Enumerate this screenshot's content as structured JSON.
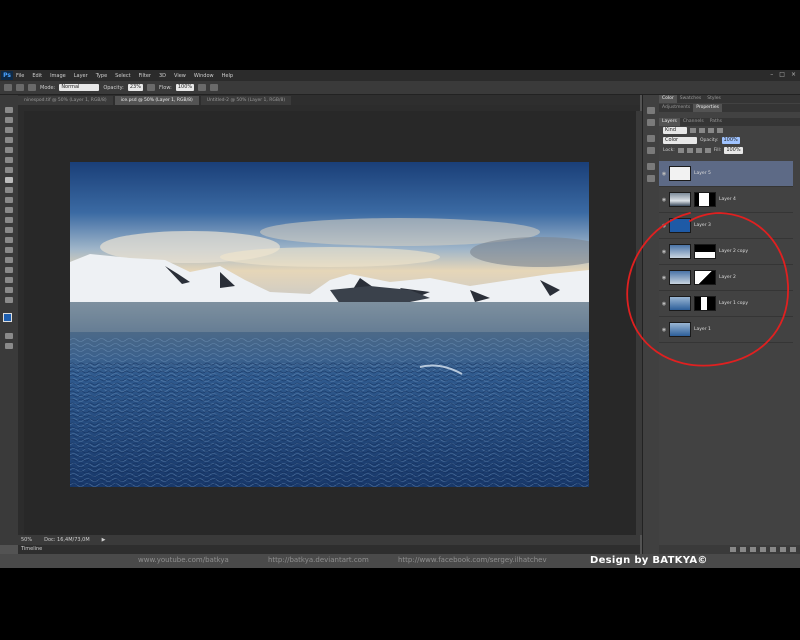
{
  "app": {
    "logo": "Ps",
    "menu": [
      "File",
      "Edit",
      "Image",
      "Layer",
      "Type",
      "Select",
      "Filter",
      "3D",
      "View",
      "Window",
      "Help"
    ],
    "window_controls": [
      "–",
      "□",
      "×"
    ]
  },
  "options": {
    "mode_label": "Mode:",
    "mode_value": "Normal",
    "opacity_label": "Opacity:",
    "opacity_value": "23%",
    "flow_label": "Flow:",
    "flow_value": "100%"
  },
  "tabs": [
    {
      "label": "ninespod.tif @ 50% (Layer 1, RGB/8)",
      "active": false
    },
    {
      "label": "ice.psd @ 50% (Layer 1, RGB/8)",
      "active": true
    },
    {
      "label": "Untitled-2 @ 50% (Layer 1, RGB/8)",
      "active": false
    }
  ],
  "status": {
    "zoom": "50%",
    "doc": "Doc: 16,4M/73,0M",
    "timeline": "Timeline"
  },
  "panels": {
    "top_tabs": [
      "Color",
      "Swatches",
      "Styles"
    ],
    "adjust_tabs": [
      "Adjustments",
      "Properties"
    ],
    "layer_tabs": [
      "Layers",
      "Channels",
      "Paths"
    ],
    "kind_label": "Kind",
    "blend_mode": "Color",
    "opacity_label": "Opacity:",
    "opacity_value": "100%",
    "lock_label": "Lock:",
    "fill_label": "Fill:",
    "fill_value": "100%"
  },
  "layers": [
    {
      "name": "Layer 5",
      "thumb": "white",
      "mask": false,
      "selected": true
    },
    {
      "name": "Layer 4",
      "thumb": "mountain",
      "mask": true,
      "selected": false
    },
    {
      "name": "Layer 3",
      "thumb": "blue",
      "mask": false,
      "selected": false
    },
    {
      "name": "Layer 2 copy",
      "thumb": "sky",
      "mask": true,
      "selected": false
    },
    {
      "name": "Layer 2",
      "thumb": "sky",
      "mask": true,
      "selected": false
    },
    {
      "name": "Layer 1 copy",
      "thumb": "sea",
      "mask": true,
      "selected": false
    },
    {
      "name": "Layer 1",
      "thumb": "sea",
      "mask": false,
      "selected": false
    }
  ],
  "footer": {
    "youtube": "www.youtube.com/batkya",
    "deviantart": "http://batkya.deviantart.com",
    "facebook": "http://www.facebook.com/sergey.ilhatchev",
    "signature": "Design by BATKYA©"
  },
  "colors": {
    "annotation": "#e02020",
    "selected_layer": "#5d6a86"
  }
}
